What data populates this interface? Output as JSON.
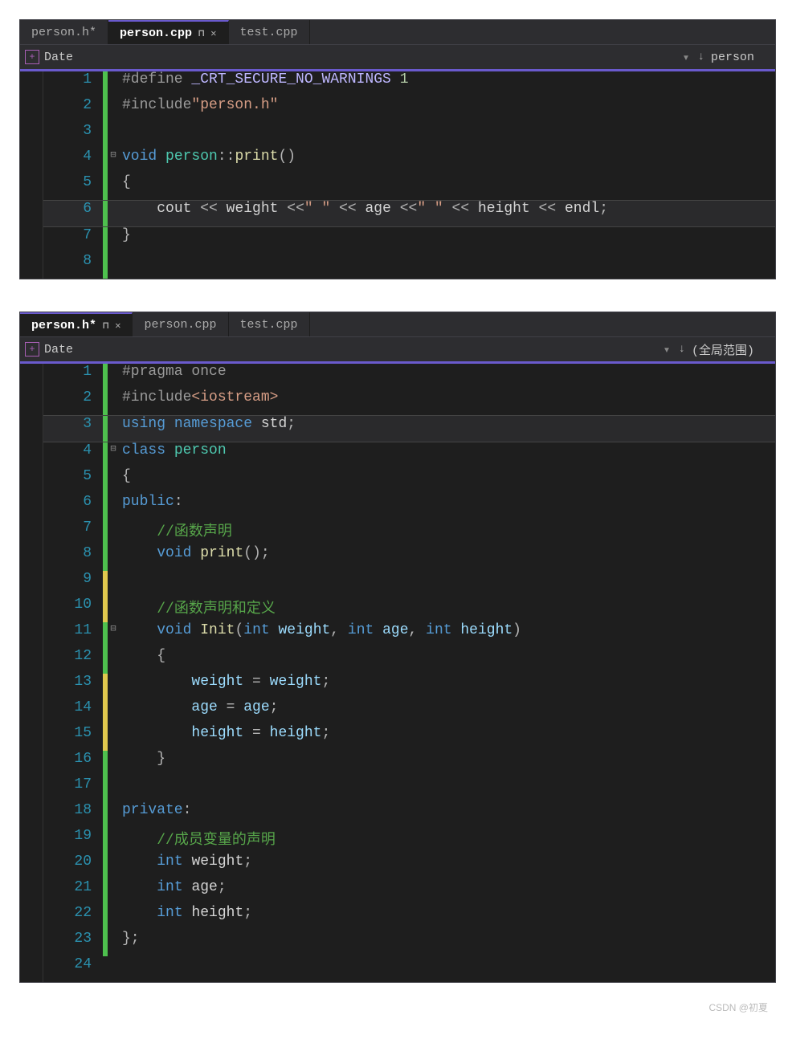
{
  "window1": {
    "tabs": [
      {
        "label": "person.h*",
        "active": false,
        "pinned": false,
        "closeable": false
      },
      {
        "label": "person.cpp",
        "active": true,
        "pinned": true,
        "closeable": true
      },
      {
        "label": "test.cpp",
        "active": false,
        "pinned": false,
        "closeable": false
      }
    ],
    "selector": {
      "left_label": "Date",
      "right_label": "person"
    },
    "code": [
      {
        "n": 1,
        "cb": "g",
        "fold": "",
        "tokens": [
          {
            "t": "#define ",
            "c": "c-pp"
          },
          {
            "t": "_CRT_SECURE_NO_WARNINGS",
            "c": "c-macro"
          },
          {
            "t": " ",
            "c": ""
          },
          {
            "t": "1",
            "c": "c-num"
          }
        ]
      },
      {
        "n": 2,
        "cb": "g",
        "fold": "",
        "tokens": [
          {
            "t": "#include",
            "c": "c-pp"
          },
          {
            "t": "\"person.h\"",
            "c": "c-str"
          }
        ]
      },
      {
        "n": 3,
        "cb": "g",
        "fold": "",
        "tokens": []
      },
      {
        "n": 4,
        "cb": "g",
        "fold": "⊟",
        "tokens": [
          {
            "t": "void ",
            "c": "c-kw"
          },
          {
            "t": "person",
            "c": "c-type"
          },
          {
            "t": "::",
            "c": "c-op"
          },
          {
            "t": "print",
            "c": "c-fn"
          },
          {
            "t": "()",
            "c": "c-op"
          }
        ]
      },
      {
        "n": 5,
        "cb": "g",
        "fold": "",
        "tokens": [
          {
            "t": "{",
            "c": "c-op"
          }
        ]
      },
      {
        "n": 6,
        "cb": "g",
        "fold": "",
        "hl": true,
        "tokens": [
          {
            "t": "    ",
            "c": ""
          },
          {
            "t": "cout",
            "c": "c-id"
          },
          {
            "t": " << ",
            "c": "c-op"
          },
          {
            "t": "weight",
            "c": "c-id"
          },
          {
            "t": " <<",
            "c": "c-op"
          },
          {
            "t": "\" \"",
            "c": "c-str"
          },
          {
            "t": " << ",
            "c": "c-op"
          },
          {
            "t": "age",
            "c": "c-id"
          },
          {
            "t": " <<",
            "c": "c-op"
          },
          {
            "t": "\" \"",
            "c": "c-str"
          },
          {
            "t": " << ",
            "c": "c-op"
          },
          {
            "t": "height",
            "c": "c-id"
          },
          {
            "t": " << ",
            "c": "c-op"
          },
          {
            "t": "endl",
            "c": "c-id"
          },
          {
            "t": ";",
            "c": "c-op"
          }
        ]
      },
      {
        "n": 7,
        "cb": "g",
        "fold": "",
        "tokens": [
          {
            "t": "}",
            "c": "c-op"
          }
        ]
      },
      {
        "n": 8,
        "cb": "g",
        "fold": "",
        "tokens": []
      }
    ]
  },
  "window2": {
    "tabs": [
      {
        "label": "person.h*",
        "active": true,
        "pinned": true,
        "closeable": true
      },
      {
        "label": "person.cpp",
        "active": false,
        "pinned": false,
        "closeable": false
      },
      {
        "label": "test.cpp",
        "active": false,
        "pinned": false,
        "closeable": false
      }
    ],
    "selector": {
      "left_label": "Date",
      "right_label": "(全局范围)"
    },
    "code": [
      {
        "n": 1,
        "cb": "g",
        "fold": "",
        "tokens": [
          {
            "t": "#pragma once",
            "c": "c-pp"
          }
        ]
      },
      {
        "n": 2,
        "cb": "g",
        "fold": "",
        "tokens": [
          {
            "t": "#include",
            "c": "c-pp"
          },
          {
            "t": "<iostream>",
            "c": "c-str"
          }
        ]
      },
      {
        "n": 3,
        "cb": "g",
        "fold": "",
        "hl": true,
        "tokens": [
          {
            "t": "using ",
            "c": "c-kw"
          },
          {
            "t": "namespace ",
            "c": "c-kw"
          },
          {
            "t": "std",
            "c": "c-id"
          },
          {
            "t": ";",
            "c": "c-op"
          }
        ]
      },
      {
        "n": 4,
        "cb": "g",
        "fold": "⊟",
        "tokens": [
          {
            "t": "class ",
            "c": "c-kw"
          },
          {
            "t": "person",
            "c": "c-type"
          }
        ]
      },
      {
        "n": 5,
        "cb": "g",
        "fold": "",
        "tokens": [
          {
            "t": "{",
            "c": "c-op"
          }
        ]
      },
      {
        "n": 6,
        "cb": "g",
        "fold": "",
        "tokens": [
          {
            "t": "public",
            "c": "c-kw"
          },
          {
            "t": ":",
            "c": "c-op"
          }
        ]
      },
      {
        "n": 7,
        "cb": "g",
        "fold": "",
        "tokens": [
          {
            "t": "    ",
            "c": ""
          },
          {
            "t": "//函数声明",
            "c": "c-cmt"
          }
        ]
      },
      {
        "n": 8,
        "cb": "g",
        "fold": "",
        "tokens": [
          {
            "t": "    ",
            "c": ""
          },
          {
            "t": "void ",
            "c": "c-kw"
          },
          {
            "t": "print",
            "c": "c-fn"
          },
          {
            "t": "();",
            "c": "c-op"
          }
        ]
      },
      {
        "n": 9,
        "cb": "y",
        "fold": "",
        "tokens": []
      },
      {
        "n": 10,
        "cb": "y",
        "fold": "",
        "tokens": [
          {
            "t": "    ",
            "c": ""
          },
          {
            "t": "//函数声明和定义",
            "c": "c-cmt"
          }
        ]
      },
      {
        "n": 11,
        "cb": "g",
        "fold": "⊟",
        "tokens": [
          {
            "t": "    ",
            "c": ""
          },
          {
            "t": "void ",
            "c": "c-kw"
          },
          {
            "t": "Init",
            "c": "c-fn"
          },
          {
            "t": "(",
            "c": "c-op"
          },
          {
            "t": "int ",
            "c": "c-kw"
          },
          {
            "t": "weight",
            "c": "c-var"
          },
          {
            "t": ", ",
            "c": "c-op"
          },
          {
            "t": "int ",
            "c": "c-kw"
          },
          {
            "t": "age",
            "c": "c-var"
          },
          {
            "t": ", ",
            "c": "c-op"
          },
          {
            "t": "int ",
            "c": "c-kw"
          },
          {
            "t": "height",
            "c": "c-var"
          },
          {
            "t": ")",
            "c": "c-op"
          }
        ]
      },
      {
        "n": 12,
        "cb": "g",
        "fold": "",
        "tokens": [
          {
            "t": "    {",
            "c": "c-op"
          }
        ]
      },
      {
        "n": 13,
        "cb": "y",
        "fold": "",
        "tokens": [
          {
            "t": "        ",
            "c": ""
          },
          {
            "t": "weight",
            "c": "c-var"
          },
          {
            "t": " = ",
            "c": "c-op"
          },
          {
            "t": "weight",
            "c": "c-var"
          },
          {
            "t": ";",
            "c": "c-op"
          }
        ]
      },
      {
        "n": 14,
        "cb": "y",
        "fold": "",
        "tokens": [
          {
            "t": "        ",
            "c": ""
          },
          {
            "t": "age",
            "c": "c-var"
          },
          {
            "t": " = ",
            "c": "c-op"
          },
          {
            "t": "age",
            "c": "c-var"
          },
          {
            "t": ";",
            "c": "c-op"
          }
        ]
      },
      {
        "n": 15,
        "cb": "y",
        "fold": "",
        "tokens": [
          {
            "t": "        ",
            "c": ""
          },
          {
            "t": "height",
            "c": "c-var"
          },
          {
            "t": " = ",
            "c": "c-op"
          },
          {
            "t": "height",
            "c": "c-var"
          },
          {
            "t": ";",
            "c": "c-op"
          }
        ]
      },
      {
        "n": 16,
        "cb": "g",
        "fold": "",
        "tokens": [
          {
            "t": "    }",
            "c": "c-op"
          }
        ]
      },
      {
        "n": 17,
        "cb": "g",
        "fold": "",
        "tokens": []
      },
      {
        "n": 18,
        "cb": "g",
        "fold": "",
        "tokens": [
          {
            "t": "private",
            "c": "c-kw"
          },
          {
            "t": ":",
            "c": "c-op"
          }
        ]
      },
      {
        "n": 19,
        "cb": "g",
        "fold": "",
        "tokens": [
          {
            "t": "    ",
            "c": ""
          },
          {
            "t": "//成员变量的声明",
            "c": "c-cmt"
          }
        ]
      },
      {
        "n": 20,
        "cb": "g",
        "fold": "",
        "tokens": [
          {
            "t": "    ",
            "c": ""
          },
          {
            "t": "int ",
            "c": "c-kw"
          },
          {
            "t": "weight",
            "c": "c-id"
          },
          {
            "t": ";",
            "c": "c-op"
          }
        ]
      },
      {
        "n": 21,
        "cb": "g",
        "fold": "",
        "tokens": [
          {
            "t": "    ",
            "c": ""
          },
          {
            "t": "int ",
            "c": "c-kw"
          },
          {
            "t": "age",
            "c": "c-id"
          },
          {
            "t": ";",
            "c": "c-op"
          }
        ]
      },
      {
        "n": 22,
        "cb": "g",
        "fold": "",
        "tokens": [
          {
            "t": "    ",
            "c": ""
          },
          {
            "t": "int ",
            "c": "c-kw"
          },
          {
            "t": "height",
            "c": "c-id"
          },
          {
            "t": ";",
            "c": "c-op"
          }
        ]
      },
      {
        "n": 23,
        "cb": "g",
        "fold": "",
        "tokens": [
          {
            "t": "};",
            "c": "c-op"
          }
        ]
      },
      {
        "n": 24,
        "cb": "",
        "fold": "",
        "tokens": []
      }
    ]
  },
  "watermark": "CSDN @初夏"
}
